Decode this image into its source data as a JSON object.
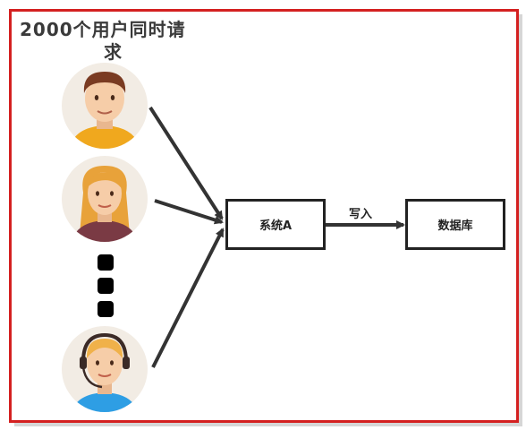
{
  "title": {
    "line1": "2000个用户同时请",
    "line2": "求"
  },
  "nodes": {
    "system": "系统A",
    "database": "数据库"
  },
  "edges": {
    "write_label": "写入"
  },
  "colors": {
    "frame": "#d42020",
    "arrow": "#333333",
    "face_bg": "#f2ece4",
    "skin": "#f6cda8",
    "user1_hair": "#7a3b22",
    "user1_shirt": "#f0a81e",
    "user2_hair": "#e8a23a",
    "user2_shirt": "#7a3a44",
    "user3_hair": "#f0b14a",
    "user3_shirt": "#2e9ee4",
    "headset": "#3b2a26"
  },
  "icons": [
    "male-user-icon",
    "female-user-icon",
    "headset-user-icon",
    "ellipsis-dots-icon"
  ]
}
